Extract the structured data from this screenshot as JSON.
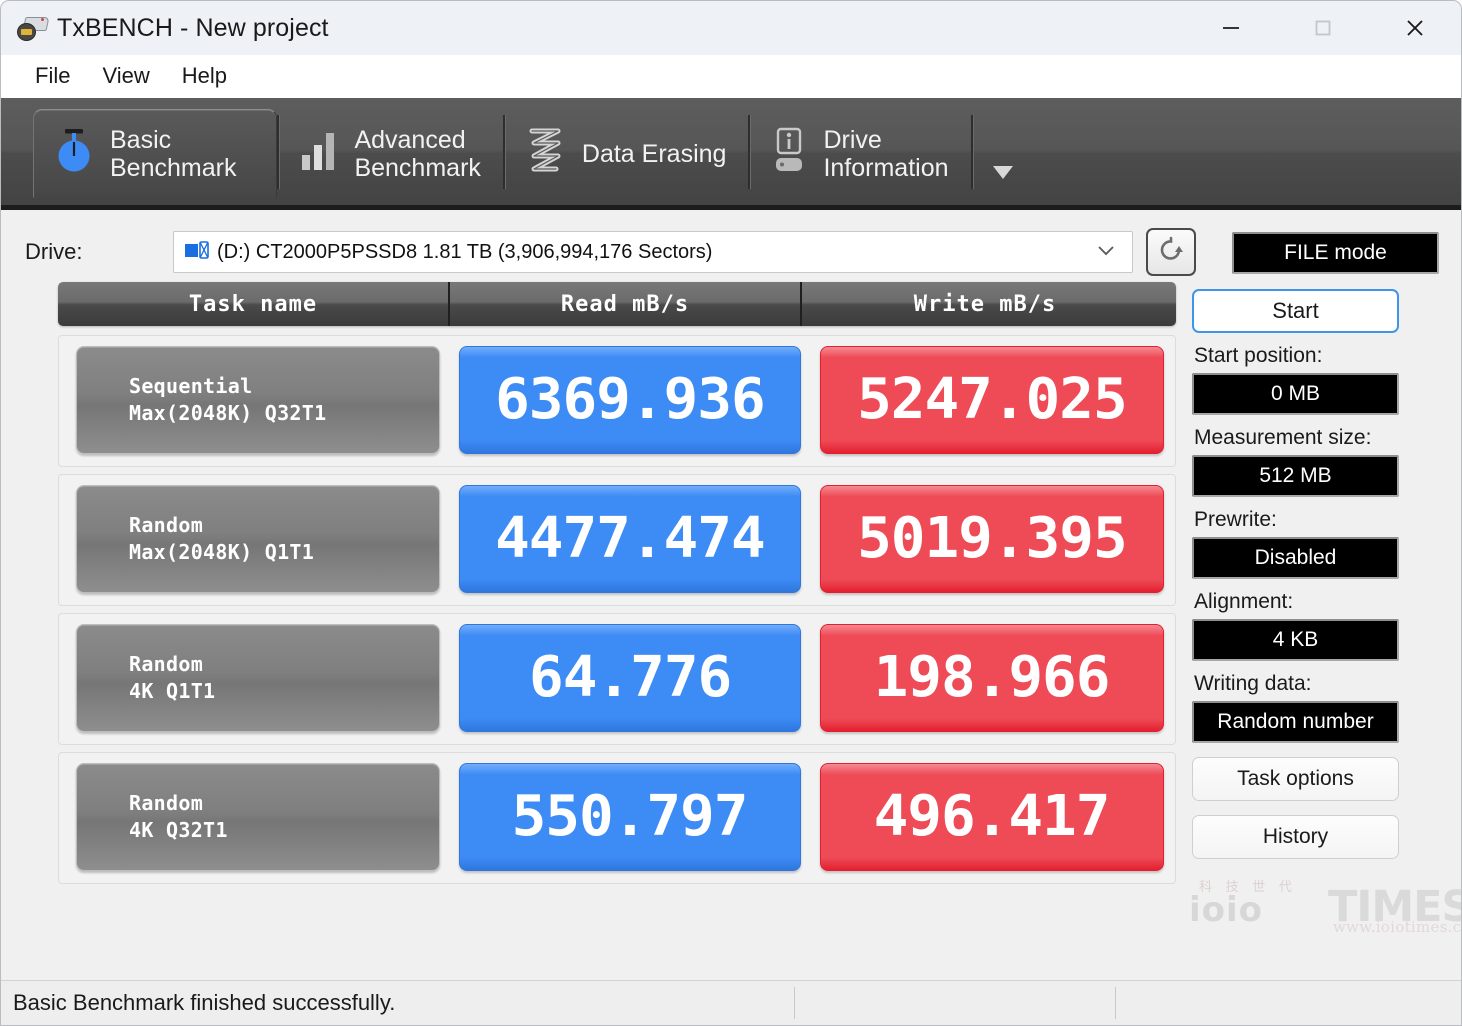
{
  "window": {
    "title": "TxBENCH - New project",
    "app_icon": "drive-app-icon",
    "controls": {
      "minimize": "minimize-icon",
      "maximize": "maximize-icon",
      "close": "close-icon"
    }
  },
  "menubar": {
    "items": [
      {
        "label": "File"
      },
      {
        "label": "View"
      },
      {
        "label": "Help"
      }
    ]
  },
  "ribbon": {
    "tabs": [
      {
        "label": "Basic\nBenchmark",
        "icon": "stopwatch-icon",
        "active": true
      },
      {
        "label": "Advanced\nBenchmark",
        "icon": "bar-chart-icon",
        "active": false
      },
      {
        "label": "Data Erasing",
        "icon": "shredder-icon",
        "active": false
      },
      {
        "label": "Drive\nInformation",
        "icon": "drive-info-icon",
        "active": false
      }
    ],
    "overflow_icon": "chevron-down-icon"
  },
  "drive": {
    "label": "Drive:",
    "value": "(D:) CT2000P5PSSD8  1.81 TB (3,906,994,176 Sectors)",
    "disk_icon": "disk-icon",
    "dropdown_icon": "chevron-down-icon",
    "refresh_icon": "refresh-icon"
  },
  "mode": {
    "file_mode_label": "FILE mode"
  },
  "table": {
    "headers": [
      "Task name",
      "Read mB/s",
      "Write mB/s"
    ],
    "rows": [
      {
        "task_line1": "Sequential",
        "task_line2": "Max(2048K) Q32T1",
        "read": "6369.936",
        "write": "5247.025"
      },
      {
        "task_line1": "Random",
        "task_line2": "Max(2048K) Q1T1",
        "read": "4477.474",
        "write": "5019.395"
      },
      {
        "task_line1": "Random",
        "task_line2": "4K Q1T1",
        "read": "64.776",
        "write": "198.966"
      },
      {
        "task_line1": "Random",
        "task_line2": "4K Q32T1",
        "read": "550.797",
        "write": "496.417"
      }
    ]
  },
  "sidepanel": {
    "start_button": "Start",
    "options": [
      {
        "label": "Start position:",
        "value": "0 MB"
      },
      {
        "label": "Measurement size:",
        "value": "512 MB"
      },
      {
        "label": "Prewrite:",
        "value": "Disabled"
      },
      {
        "label": "Alignment:",
        "value": "4 KB"
      },
      {
        "label": "Writing data:",
        "value": "Random number"
      }
    ],
    "task_options_button": "Task options",
    "history_button": "History"
  },
  "statusbar": {
    "message": "Basic Benchmark finished successfully."
  },
  "watermark": {
    "chinese": "科 技 世 代",
    "brand": "ioio",
    "times": "TIMES",
    "url": "www.ioiotimes.com"
  },
  "colors": {
    "read_blue": "#3d8bf5",
    "write_red": "#ee4b57",
    "accent_blue": "#3f96e8",
    "ribbon_gray": "#4f4f4f"
  }
}
